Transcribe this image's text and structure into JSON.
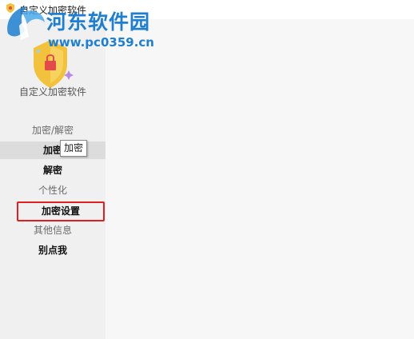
{
  "window": {
    "title": "自定义加密软件"
  },
  "watermark": {
    "site_name": "河东软件园",
    "url": "www.pc0359.cn"
  },
  "sidebar": {
    "app_name": "自定义加密软件",
    "items": [
      {
        "label": "加密/解密"
      },
      {
        "label": "加密"
      },
      {
        "label": "解密"
      },
      {
        "label": "个性化"
      },
      {
        "label": "加密设置"
      },
      {
        "label": "其他信息"
      },
      {
        "label": "别点我"
      }
    ]
  },
  "tooltip": {
    "text": "加密"
  },
  "colors": {
    "accent_watermark": "#1e7fd0",
    "highlight_box": "#e02020",
    "shield_gold": "#f3c23c",
    "shield_red": "#e34b4b"
  }
}
